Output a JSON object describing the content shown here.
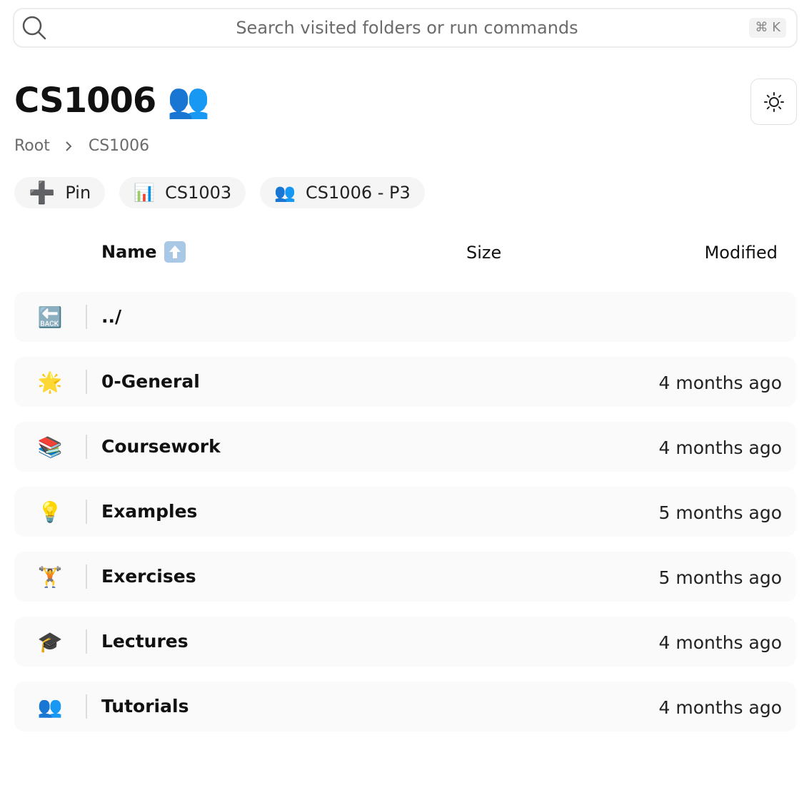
{
  "search": {
    "placeholder": "Search visited folders or run commands",
    "shortcut": "⌘ K"
  },
  "header": {
    "title": "CS1006",
    "title_emoji": "👥",
    "theme_toggle_icon": "sun-icon"
  },
  "breadcrumb": {
    "items": [
      "Root",
      "CS1006"
    ]
  },
  "chips": [
    {
      "emoji": "➕",
      "label": "Pin"
    },
    {
      "emoji": "📊",
      "label": "CS1003"
    },
    {
      "emoji": "👥",
      "label": "CS1006 - P3"
    }
  ],
  "columns": {
    "name": "Name",
    "name_sort_icon": "arrow-up-icon",
    "size": "Size",
    "modified": "Modified"
  },
  "rows": [
    {
      "emoji": "🔙",
      "name": "../",
      "modified": ""
    },
    {
      "emoji": "🌟",
      "name": "0-General",
      "modified": "4 months ago"
    },
    {
      "emoji": "📚",
      "name": "Coursework",
      "modified": "4 months ago"
    },
    {
      "emoji": "💡",
      "name": "Examples",
      "modified": "5 months ago"
    },
    {
      "emoji": "🏋",
      "name": "Exercises",
      "modified": "5 months ago"
    },
    {
      "emoji": "🎓",
      "name": "Lectures",
      "modified": "4 months ago"
    },
    {
      "emoji": "👥",
      "name": "Tutorials",
      "modified": "4 months ago"
    }
  ]
}
